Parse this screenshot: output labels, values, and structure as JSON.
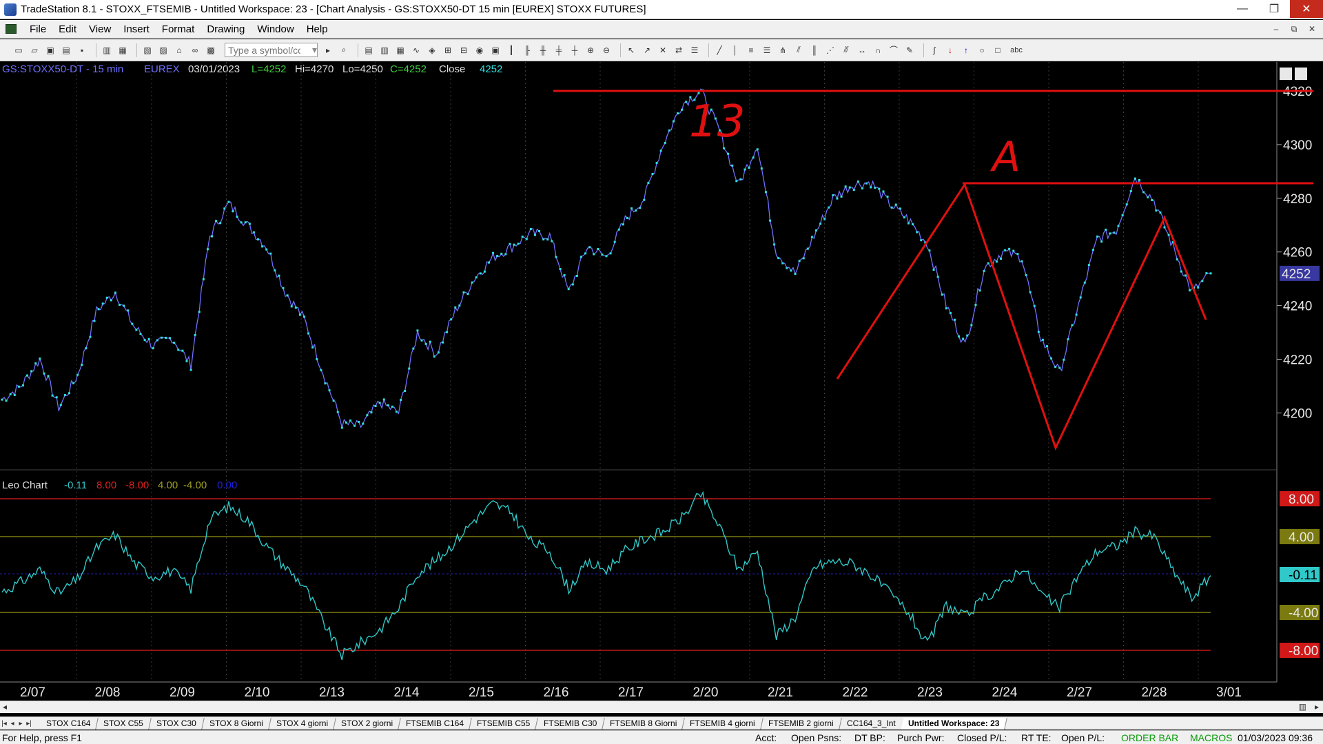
{
  "window": {
    "title": "TradeStation 8.1 - STOXX_FTSEMIB - Untitled Workspace:  23 - [Chart Analysis - GS:STOXX50-DT  15 min  [EUREX] STOXX FUTURES]",
    "minimize": "—",
    "maximize": "❐",
    "close": "✕"
  },
  "menu": {
    "items": [
      "File",
      "Edit",
      "View",
      "Insert",
      "Format",
      "Drawing",
      "Window",
      "Help"
    ],
    "mdi": [
      "–",
      "⧉",
      "✕"
    ]
  },
  "toolbar": {
    "symbol_placeholder": "Type a symbol/co",
    "abc_label": "abc"
  },
  "chart": {
    "header": {
      "symbol": "GS:STOXX50-DT - 15 min",
      "exchange": "EUREX",
      "date": "03/01/2023",
      "last": "L=4252",
      "high": "Hi=4270",
      "low": "Lo=4250",
      "close_eq": "C=4252",
      "close_label": "Close",
      "close_value": "4252"
    },
    "price_axis": [
      "4320",
      "4300",
      "4280",
      "4260",
      "4240",
      "4220",
      "4200"
    ],
    "price_last_tag": "4252",
    "annotations": {
      "label_b": "13",
      "label_a": "A"
    },
    "indicator": {
      "name": "Leo Chart",
      "values": [
        "-0.11",
        "8.00",
        "-8.00",
        "4.00",
        "-4.00",
        "0.00"
      ],
      "axis_tags": [
        "8.00",
        "4.00",
        "-0.11",
        "-4.00",
        "-8.00"
      ]
    },
    "date_axis": [
      "2/07",
      "2/08",
      "2/09",
      "2/10",
      "2/13",
      "2/14",
      "2/15",
      "2/16",
      "2/17",
      "2/20",
      "2/21",
      "2/22",
      "2/23",
      "2/24",
      "2/27",
      "2/28",
      "3/01"
    ],
    "colors": {
      "price_line": "#7070ff",
      "price_dots": "#30e0e0",
      "indicator": "#30c8c8",
      "drawing": "#e01010",
      "band_outer": "#c01818",
      "band_inner": "#7a7a10",
      "zero": "#2020c0",
      "grid": "#3a3a3a"
    }
  },
  "chart_data": {
    "type": "line",
    "title": "GS:STOXX50-DT - 15 min",
    "x": [
      "2/07",
      "2/07",
      "2/07",
      "2/08",
      "2/08",
      "2/08",
      "2/08",
      "2/09",
      "2/09",
      "2/09",
      "2/09",
      "2/10",
      "2/10",
      "2/10",
      "2/10",
      "2/13",
      "2/13",
      "2/13",
      "2/13",
      "2/14",
      "2/14",
      "2/14",
      "2/14",
      "2/15",
      "2/15",
      "2/15",
      "2/15",
      "2/16",
      "2/16",
      "2/16",
      "2/16",
      "2/17",
      "2/17",
      "2/17",
      "2/17",
      "2/20",
      "2/20",
      "2/20",
      "2/20",
      "2/21",
      "2/21",
      "2/21",
      "2/21",
      "2/22",
      "2/22",
      "2/22",
      "2/22",
      "2/23",
      "2/23",
      "2/23",
      "2/23",
      "2/24",
      "2/24",
      "2/24",
      "2/24",
      "2/27",
      "2/27",
      "2/27",
      "2/27",
      "2/28",
      "2/28",
      "2/28",
      "2/28",
      "3/01",
      "3/01"
    ],
    "series": [
      {
        "values": [
          4205,
          4210,
          4220,
          4202,
          4214,
          4238,
          4245,
          4232,
          4225,
          4228,
          4218,
          4266,
          4278,
          4270,
          4262,
          4245,
          4235,
          4215,
          4196,
          4195,
          4204,
          4200,
          4230,
          4222,
          4238,
          4250,
          4258,
          4262,
          4267,
          4266,
          4245,
          4262,
          4258,
          4272,
          4280,
          4300,
          4315,
          4320,
          4305,
          4285,
          4300,
          4260,
          4252,
          4266,
          4280,
          4285,
          4286,
          4278,
          4272,
          4263,
          4240,
          4225,
          4254,
          4260,
          4258,
          4228,
          4215,
          4240,
          4265,
          4268,
          4288,
          4279,
          4262,
          4245,
          4252
        ]
      },
      {
        "values": [
          -1.8,
          -0.8,
          0.5,
          -2.0,
          -0.5,
          2.8,
          4.2,
          1.2,
          -0.2,
          0.4,
          -1.5,
          5.8,
          7.2,
          5.8,
          3.0,
          0.8,
          -1.2,
          -5.0,
          -8.5,
          -7.2,
          -5.8,
          -3.5,
          0.2,
          1.5,
          3.5,
          5.8,
          7.5,
          6.5,
          3.5,
          2.5,
          -1.5,
          1.2,
          0.5,
          2.5,
          3.8,
          4.5,
          6.0,
          8.5,
          5.0,
          0.5,
          2.5,
          -6.5,
          -4.5,
          0.8,
          1.4,
          1.2,
          0.0,
          -2.0,
          -4.0,
          -7.5,
          -3.2,
          -4.5,
          -2.5,
          -1.2,
          0.8,
          -2.0,
          -3.5,
          0.0,
          2.5,
          3.0,
          4.5,
          4.0,
          0.5,
          -2.5,
          -0.11
        ]
      }
    ],
    "ylim": [
      4185,
      4325
    ],
    "indicator_ylim": [
      -10,
      10
    ],
    "grid": true
  }
}
